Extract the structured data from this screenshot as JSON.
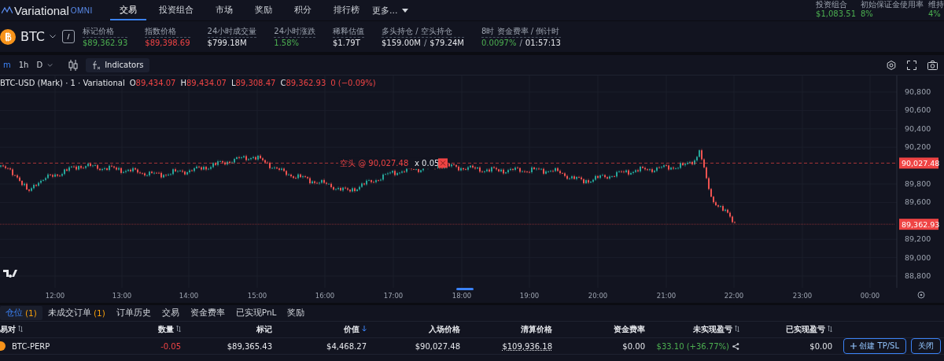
{
  "nav": {
    "logo": "Variational",
    "logo_badge": "OMNI",
    "items": [
      {
        "label": "交易",
        "selected": true
      },
      {
        "label": "投资组合",
        "selected": false
      },
      {
        "label": "市场",
        "selected": false
      },
      {
        "label": "奖励",
        "selected": false
      },
      {
        "label": "积分",
        "selected": false
      },
      {
        "label": "排行榜",
        "selected": false
      }
    ],
    "more": "更多..."
  },
  "account": [
    {
      "label": "投资组合",
      "value": "$1,083.51"
    },
    {
      "label": "初始保证金使用率",
      "value": "8%"
    },
    {
      "label": "维持",
      "value": "4%"
    }
  ],
  "ticker": {
    "symbol": "BTC",
    "stats": [
      {
        "label": "标记价格",
        "parts": [
          {
            "text": "$89,362.93",
            "color": "#4caf50"
          }
        ]
      },
      {
        "label": "指数价格",
        "parts": [
          {
            "text": "$89,398.69",
            "color": "#ef4444"
          }
        ]
      },
      {
        "label": "24小时成交量",
        "parts": [
          {
            "text": "$799.18M",
            "color": "#e5e7eb"
          }
        ]
      },
      {
        "label": "24小时涨跌",
        "parts": [
          {
            "text": "1.58%",
            "color": "#4caf50"
          }
        ]
      },
      {
        "label": "稀释估值",
        "parts": [
          {
            "text": "$1.79T",
            "color": "#e5e7eb"
          }
        ]
      },
      {
        "label": "多头持仓 / 空头持仓",
        "parts": [
          {
            "text": "$159.00M",
            "color": "#e5e7eb"
          },
          {
            "text": "/"
          },
          {
            "text": "$79.24M",
            "color": "#e5e7eb"
          }
        ]
      },
      {
        "label": "8时 资金费率 / 倒计时",
        "parts": [
          {
            "text": "0.0097%",
            "color": "#4caf50"
          },
          {
            "text": "/"
          },
          {
            "text": "01:57:13",
            "color": "#e5e7eb"
          }
        ]
      }
    ]
  },
  "toolbar": {
    "intervals": [
      {
        "label": "m",
        "selected": true
      },
      {
        "label": "1h",
        "selected": false
      },
      {
        "label": "D",
        "selected": false
      }
    ],
    "indicators": "Indicators"
  },
  "legend": {
    "title": "BTC-USD (Mark) · 1 · Variational",
    "ohlc": [
      {
        "key": "O",
        "value": "89,434.07"
      },
      {
        "key": "H",
        "value": "89,434.07"
      },
      {
        "key": "L",
        "value": "89,308.47"
      },
      {
        "key": "C",
        "value": "89,362.93"
      }
    ],
    "change": "0 (−0.09%)"
  },
  "order_line": {
    "label": "空头 @ 90,027.48",
    "qty": "x 0.05"
  },
  "price_axis": {
    "ticks": [
      "90,800",
      "90,600",
      "90,400",
      "90,200",
      "89,800",
      "89,600",
      "89,200",
      "89,000",
      "88,800"
    ],
    "tags": [
      "90,027.48",
      "89,362.93"
    ]
  },
  "time_axis": [
    "12:00",
    "13:00",
    "14:00",
    "15:00",
    "16:00",
    "17:00",
    "18:00",
    "19:00",
    "20:00",
    "21:00",
    "22:00",
    "23:00",
    "00:00"
  ],
  "bottom_tabs": [
    {
      "label": "仓位",
      "count": "(1)",
      "selected": true
    },
    {
      "label": "未成交订单",
      "count": "(1)",
      "selected": false
    },
    {
      "label": "订单历史",
      "selected": false
    },
    {
      "label": "交易",
      "selected": false
    },
    {
      "label": "资金费率",
      "selected": false
    },
    {
      "label": "已实现PnL",
      "selected": false
    },
    {
      "label": "奖励",
      "selected": false
    }
  ],
  "positions": {
    "columns": [
      {
        "label": "易对",
        "sortable": true,
        "sorted": false
      },
      {
        "label": "数量",
        "sortable": true,
        "sorted": false
      },
      {
        "label": "标记",
        "sortable": false,
        "sorted": false
      },
      {
        "label": "价值",
        "sortable": false,
        "sorted": true
      },
      {
        "label": "入场价格",
        "sortable": false,
        "sorted": false
      },
      {
        "label": "清算价格",
        "sortable": false,
        "sorted": false
      },
      {
        "label": "资金费率",
        "sortable": false,
        "sorted": false
      },
      {
        "label": "未实现盈亏",
        "sortable": true,
        "sorted": false
      },
      {
        "label": "已实现盈亏",
        "sortable": true,
        "sorted": false
      }
    ],
    "rows": [
      {
        "pair": "BTC-PERP",
        "qty": "-0.05",
        "mark": "$89,365.43",
        "value": "$4,468.27",
        "entry": "$90,027.48",
        "liq": "$109,936.18",
        "funding": "$0.00",
        "upnl": "$33.10 (+36.77%)",
        "rpnl": "$0.00"
      }
    ],
    "actions": [
      "创建 TP/SL",
      "关闭"
    ]
  }
}
